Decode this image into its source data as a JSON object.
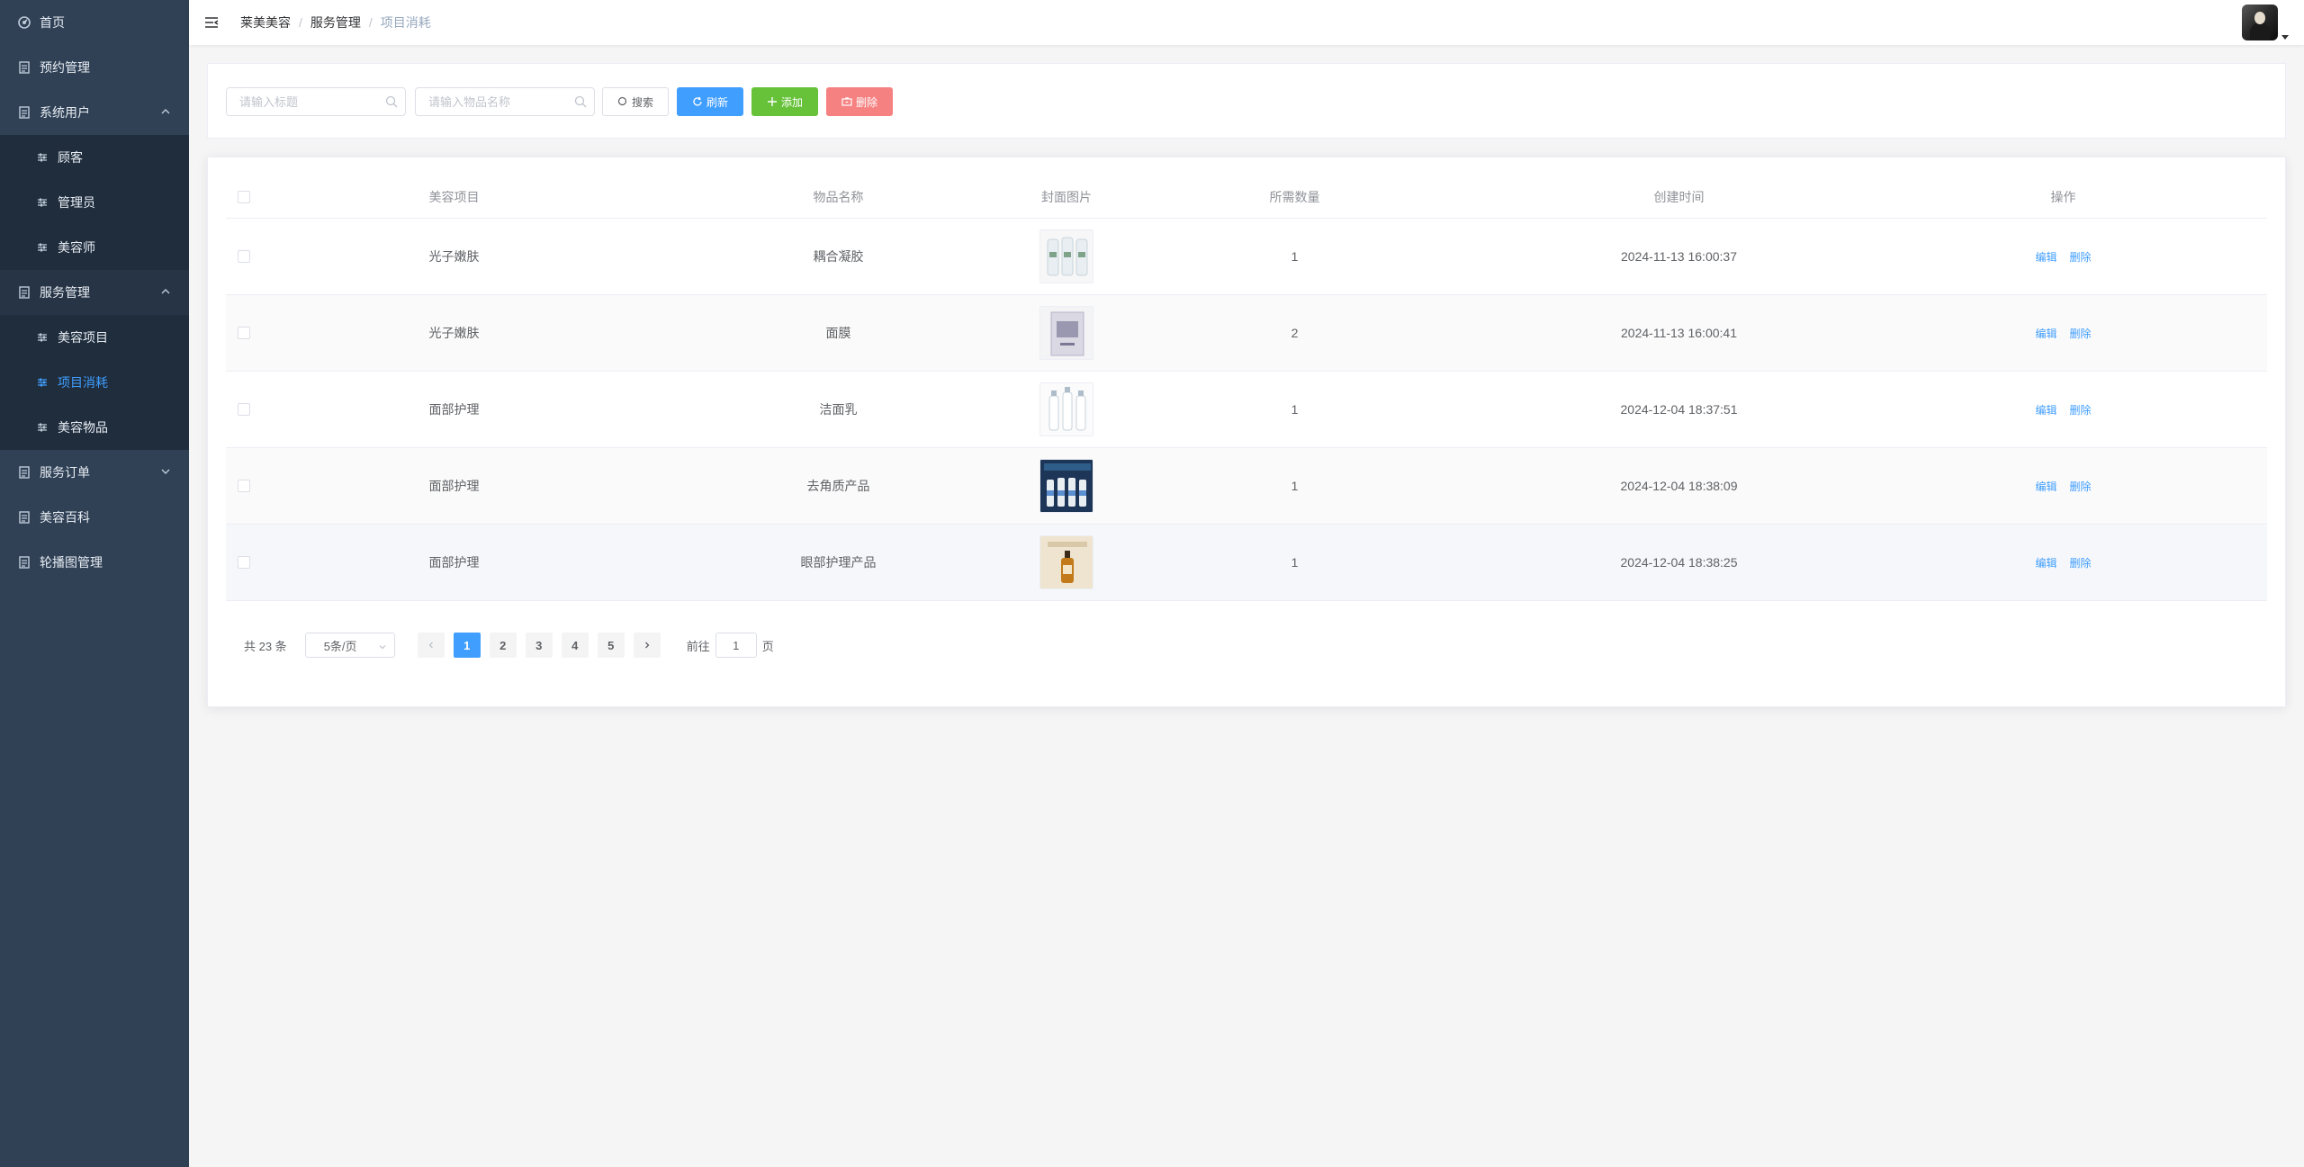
{
  "sidebar": {
    "items": [
      {
        "label": "首页",
        "icon": "dashboard-icon"
      },
      {
        "label": "预约管理",
        "icon": "document-icon"
      },
      {
        "label": "系统用户",
        "icon": "document-icon",
        "expanded": true,
        "children": [
          {
            "label": "顾客"
          },
          {
            "label": "管理员"
          },
          {
            "label": "美容师"
          }
        ]
      },
      {
        "label": "服务管理",
        "icon": "document-icon",
        "expanded": true,
        "children": [
          {
            "label": "美容项目"
          },
          {
            "label": "项目消耗",
            "active": true
          },
          {
            "label": "美容物品"
          }
        ]
      },
      {
        "label": "服务订单",
        "icon": "document-icon",
        "expanded": false
      },
      {
        "label": "美容百科",
        "icon": "document-icon"
      },
      {
        "label": "轮播图管理",
        "icon": "document-icon"
      }
    ]
  },
  "header": {
    "breadcrumb": [
      "莱美美容",
      "服务管理",
      "项目消耗"
    ]
  },
  "search": {
    "title_placeholder": "请输入标题",
    "item_placeholder": "请输入物品名称",
    "search_label": "搜索",
    "refresh_label": "刷新",
    "add_label": "添加",
    "delete_label": "删除"
  },
  "table": {
    "columns": [
      "美容项目",
      "物品名称",
      "封面图片",
      "所需数量",
      "创建时间",
      "操作"
    ],
    "rows": [
      {
        "project": "光子嫩肤",
        "item": "耦合凝胶",
        "qty": "1",
        "time": "2024-11-13 16:00:37"
      },
      {
        "project": "光子嫩肤",
        "item": "面膜",
        "qty": "2",
        "time": "2024-11-13 16:00:41"
      },
      {
        "project": "面部护理",
        "item": "洁面乳",
        "qty": "1",
        "time": "2024-12-04 18:37:51"
      },
      {
        "project": "面部护理",
        "item": "去角质产品",
        "qty": "1",
        "time": "2024-12-04 18:38:09"
      },
      {
        "project": "面部护理",
        "item": "眼部护理产品",
        "qty": "1",
        "time": "2024-12-04 18:38:25"
      }
    ],
    "edit_label": "编辑",
    "delete_label": "删除"
  },
  "pagination": {
    "total_text": "共 23 条",
    "page_size": "5条/页",
    "pages": [
      "1",
      "2",
      "3",
      "4",
      "5"
    ],
    "current": "1",
    "goto_prefix": "前往",
    "goto_value": "1",
    "goto_suffix": "页"
  },
  "colors": {
    "sidebar_bg": "#304156",
    "submenu_bg": "#1f2d3d",
    "primary": "#409eff",
    "success": "#67c23a",
    "danger": "#f56c6c"
  }
}
